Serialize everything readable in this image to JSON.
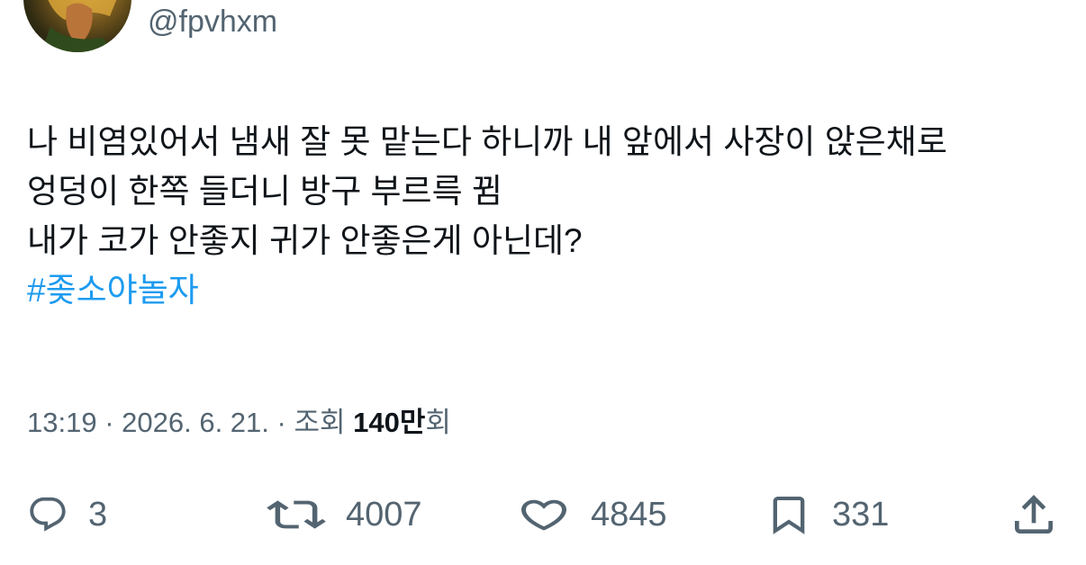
{
  "author": {
    "handle": "@fpvhxm",
    "avatar_icon": "avatar-image"
  },
  "tweet": {
    "lines": [
      "나 비염있어서 냄새 잘 못 맡는다 하니까 내 앞에서 사장이 앉은채로",
      "엉덩이 한쪽 들더니 방구 부르륵 뀜",
      "내가 코가 안좋지 귀가 안좋은게 아닌데?"
    ],
    "hashtag": "#좆소야놀자"
  },
  "meta": {
    "time": "13:19",
    "separator": "·",
    "date": "2026. 6. 21.",
    "views_label": "조회",
    "views_count": "140만",
    "views_suffix": "회"
  },
  "actions": {
    "reply": {
      "icon": "reply-icon",
      "count": "3"
    },
    "retweet": {
      "icon": "retweet-icon",
      "count": "4007"
    },
    "like": {
      "icon": "heart-icon",
      "count": "4845"
    },
    "bookmark": {
      "icon": "bookmark-icon",
      "count": "331"
    },
    "share": {
      "icon": "share-icon"
    }
  },
  "colors": {
    "text": "#0f1419",
    "secondary": "#536471",
    "link": "#1d9bf0",
    "background": "#ffffff"
  }
}
